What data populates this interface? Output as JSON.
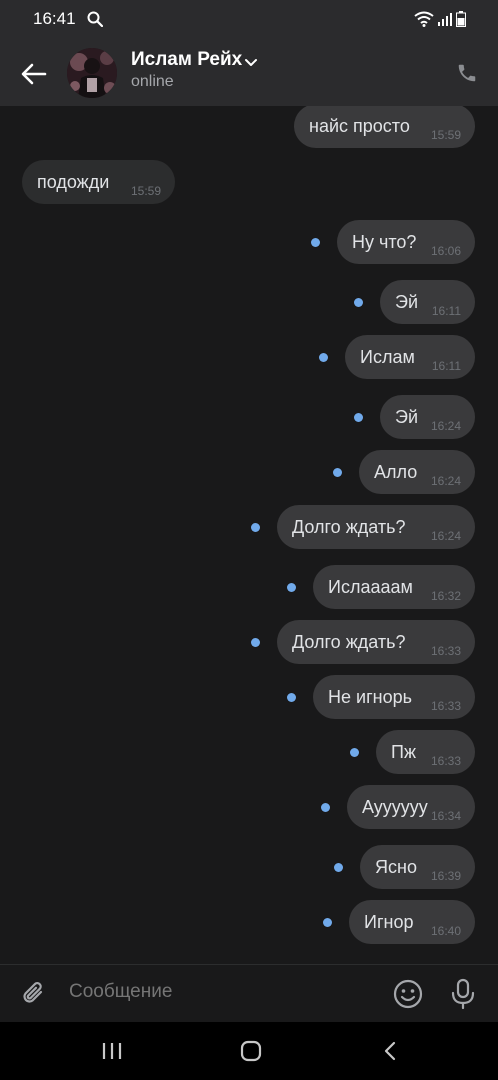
{
  "status_bar": {
    "time": "16:41"
  },
  "header": {
    "name": "Ислам Рейх",
    "status": "online"
  },
  "messages": [
    {
      "text": "найс просто",
      "time": "15:59",
      "dir": "out",
      "unread": false
    },
    {
      "text": "подожди",
      "time": "15:59",
      "dir": "in",
      "unread": false
    },
    {
      "text": "Ну что?",
      "time": "16:06",
      "dir": "out",
      "unread": true
    },
    {
      "text": "Эй",
      "time": "16:11",
      "dir": "out",
      "unread": true
    },
    {
      "text": "Ислам",
      "time": "16:11",
      "dir": "out",
      "unread": true
    },
    {
      "text": "Эй",
      "time": "16:24",
      "dir": "out",
      "unread": true
    },
    {
      "text": "Алло",
      "time": "16:24",
      "dir": "out",
      "unread": true
    },
    {
      "text": "Долго ждать?",
      "time": "16:24",
      "dir": "out",
      "unread": true
    },
    {
      "text": "Ислаааам",
      "time": "16:32",
      "dir": "out",
      "unread": true
    },
    {
      "text": "Долго ждать?",
      "time": "16:33",
      "dir": "out",
      "unread": true
    },
    {
      "text": "Не игнорь",
      "time": "16:33",
      "dir": "out",
      "unread": true
    },
    {
      "text": "Пж",
      "time": "16:33",
      "dir": "out",
      "unread": true
    },
    {
      "text": "Ауууууу",
      "time": "16:34",
      "dir": "out",
      "unread": true
    },
    {
      "text": "Ясно",
      "time": "16:39",
      "dir": "out",
      "unread": true
    },
    {
      "text": "Игнор",
      "time": "16:40",
      "dir": "out",
      "unread": true
    }
  ],
  "composer": {
    "placeholder": "Сообщение"
  },
  "colors": {
    "accent": "#71aaeb",
    "bubble": "#3a3a3c",
    "background": "#19191a",
    "header": "#2b2b2d"
  }
}
